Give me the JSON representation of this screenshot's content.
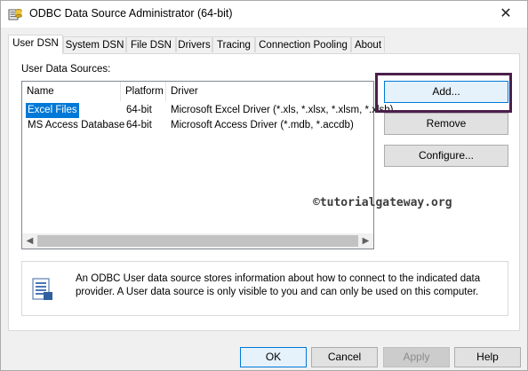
{
  "window": {
    "title": "ODBC Data Source Administrator (64-bit)",
    "close_label": "✕"
  },
  "tabs": [
    {
      "label": "User DSN",
      "active": true
    },
    {
      "label": "System DSN"
    },
    {
      "label": "File DSN"
    },
    {
      "label": "Drivers"
    },
    {
      "label": "Tracing"
    },
    {
      "label": "Connection Pooling"
    },
    {
      "label": "About"
    }
  ],
  "user_dsn": {
    "list_label": "User Data Sources:",
    "columns": {
      "name": "Name",
      "platform": "Platform",
      "driver": "Driver"
    },
    "rows": [
      {
        "name": "Excel Files",
        "platform": "64-bit",
        "driver": "Microsoft Excel Driver (*.xls, *.xlsx, *.xlsm, *.xlsb)",
        "selected": true
      },
      {
        "name": "MS Access Database",
        "platform": "64-bit",
        "driver": "Microsoft Access Driver (*.mdb, *.accdb)"
      }
    ],
    "buttons": {
      "add": "Add...",
      "remove": "Remove",
      "configure": "Configure..."
    },
    "info_text": "An ODBC User data source stores information about how to connect to the indicated data provider.   A User data source is only visible to you and can only be used on this computer.",
    "watermark": "©tutorialgateway.org"
  },
  "footer": {
    "ok": "OK",
    "cancel": "Cancel",
    "apply": "Apply",
    "help": "Help"
  },
  "colors": {
    "selection": "#0078d7",
    "highlight_box": "#4b1f4b"
  }
}
